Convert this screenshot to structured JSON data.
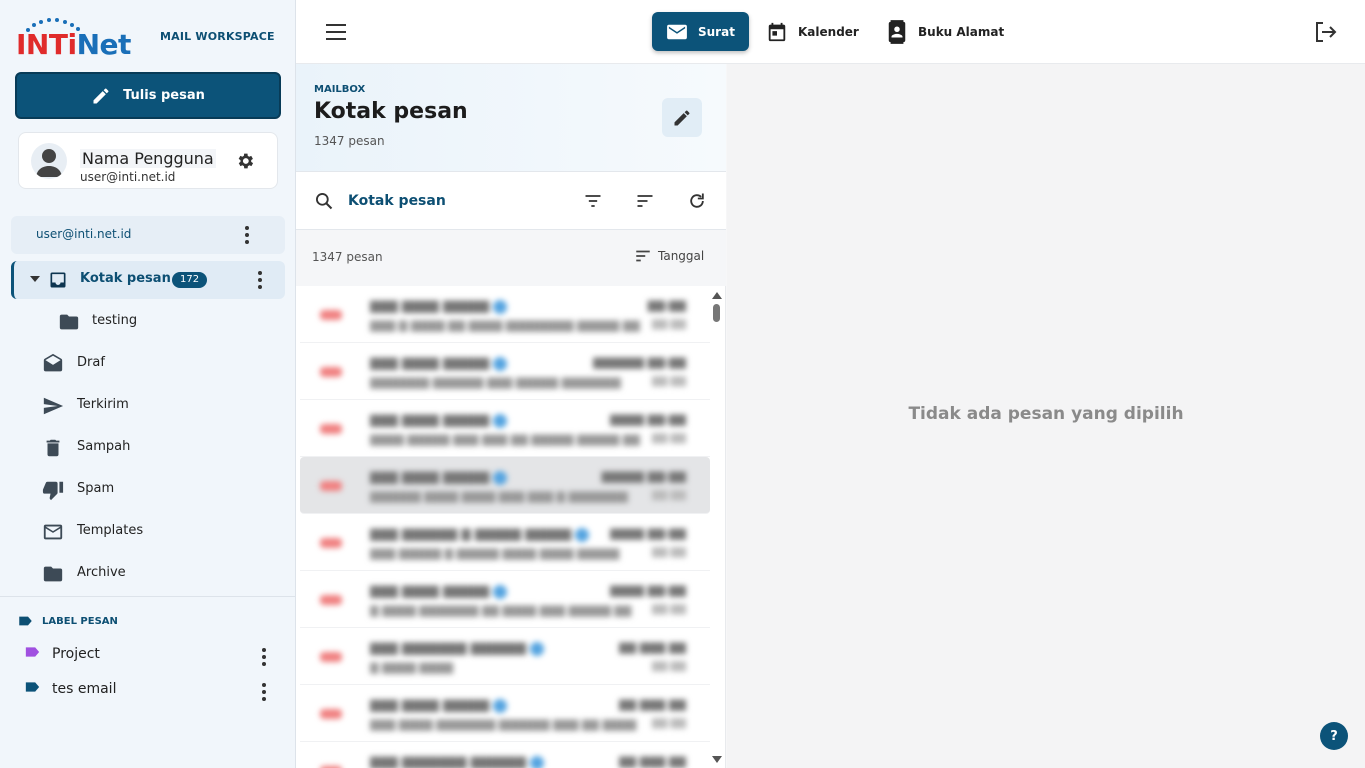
{
  "brand": {
    "logo_text_red": "INTi",
    "logo_text_blue": "Net",
    "workspace_label": "MAIL WORKSPACE",
    "accent": "#0c5379"
  },
  "compose": {
    "label": "Tulis pesan"
  },
  "user": {
    "name": "Nama Pengguna",
    "email": "user@inti.net.id"
  },
  "account": {
    "email": "user@inti.net.id"
  },
  "inbox": {
    "label": "Kotak pesan",
    "unread": "172"
  },
  "folders": [
    {
      "label": "testing",
      "icon": "folder-icon"
    },
    {
      "label": "Draf",
      "icon": "draft-envelope-icon"
    },
    {
      "label": "Terkirim",
      "icon": "send-icon"
    },
    {
      "label": "Sampah",
      "icon": "trash-icon"
    },
    {
      "label": "Spam",
      "icon": "thumbs-down-icon"
    },
    {
      "label": "Templates",
      "icon": "mail-icon"
    },
    {
      "label": "Archive",
      "icon": "folder-icon"
    }
  ],
  "labels_section": {
    "title": "LABEL PESAN",
    "items": [
      {
        "label": "Project",
        "color": "#a050e0"
      },
      {
        "label": "tes email",
        "color": "#0c5379"
      }
    ]
  },
  "topbar": {
    "nav": [
      {
        "label": "Surat",
        "active": true
      },
      {
        "label": "Kalender",
        "active": false
      },
      {
        "label": "Buku Alamat",
        "active": false
      }
    ]
  },
  "mailbox": {
    "kicker": "MAILBOX",
    "title": "Kotak pesan",
    "count_label": "1347 pesan"
  },
  "search": {
    "value": "Kotak pesan"
  },
  "list_bar": {
    "count_label": "1347 pesan",
    "sort_label": "Tanggal"
  },
  "reading_pane": {
    "empty_label": "Tidak ada pesan yang dipilih",
    "help_label": "?"
  }
}
